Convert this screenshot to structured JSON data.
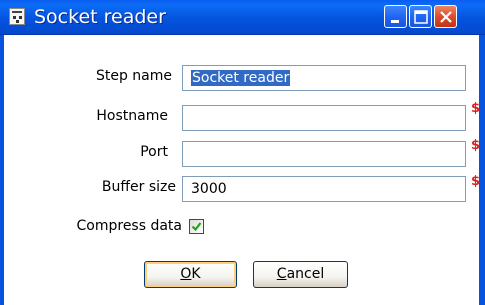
{
  "window": {
    "title": "Socket reader",
    "icon": "app-window-icon",
    "controls": {
      "minimize": "minimize-icon",
      "maximize": "maximize-icon",
      "close": "close-icon"
    }
  },
  "form": {
    "step_name": {
      "label": "Step name",
      "value": "Socket reader"
    },
    "hostname": {
      "label": "Hostname",
      "value": "",
      "variable_marker": "$"
    },
    "port": {
      "label": "Port",
      "value": "",
      "variable_marker": "$"
    },
    "buffer_size": {
      "label": "Buffer size",
      "value": "3000",
      "variable_marker": "$"
    },
    "compress_data": {
      "label": "Compress data",
      "checked": true
    }
  },
  "buttons": {
    "ok": {
      "mnemonic": "O",
      "rest": "K"
    },
    "cancel": {
      "mnemonic": "C",
      "rest": "ancel"
    }
  },
  "colors": {
    "titlebar": "#0553de",
    "close_button": "#d94a2b",
    "selection": "#316ac5",
    "variable_marker": "#e02020",
    "field_border": "#7f9db9"
  }
}
